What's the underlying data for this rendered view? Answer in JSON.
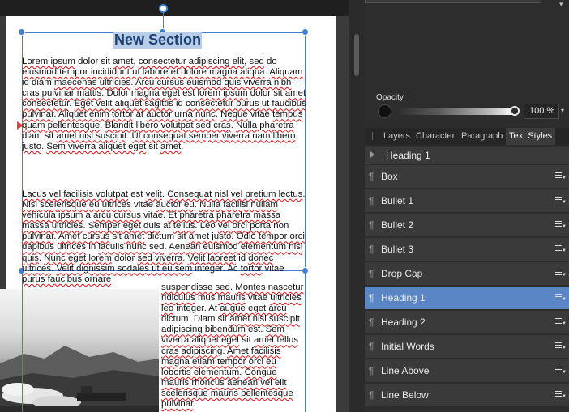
{
  "document": {
    "heading": "New Section",
    "paragraphs": [
      [
        {
          "t": "Lorem ipsum",
          "s": 1
        },
        {
          "t": " dolor sit "
        },
        {
          "t": "amet",
          "s": 1
        },
        {
          "t": ", "
        },
        {
          "t": "consectetur adipiscing elit",
          "s": 1
        },
        {
          "t": ", "
        },
        {
          "t": "sed",
          "s": 1
        },
        {
          "t": " do "
        },
        {
          "t": "eiusmod tempor incididunt ut labore et dolore magna aliqua",
          "s": 1
        },
        {
          "t": ". "
        },
        {
          "t": "Aliquam",
          "s": 1
        },
        {
          "t": " id diam "
        },
        {
          "t": "maecenas ultricies",
          "s": 1
        },
        {
          "t": ". "
        },
        {
          "t": "Arcu cursus euismod quis viverra nibh cras pulvinar mattis",
          "s": 1
        },
        {
          "t": ". Dolor "
        },
        {
          "t": "magna eget",
          "s": 1
        },
        {
          "t": " est "
        },
        {
          "t": "lorem ipsum",
          "s": 1
        },
        {
          "t": " dolor sit "
        },
        {
          "t": "amet consectetur",
          "s": 1
        },
        {
          "t": ". "
        },
        {
          "t": "Eget velit aliquet sagittis",
          "s": 1
        },
        {
          "t": " id "
        },
        {
          "t": "consectetur purus ut faucibus pulvinar",
          "s": 1
        },
        {
          "t": ". "
        },
        {
          "t": "Aliquet enim tortor",
          "s": 1
        },
        {
          "t": " at "
        },
        {
          "t": "auctor urna nunc",
          "s": 1
        },
        {
          "t": ". "
        },
        {
          "t": "Neque",
          "s": 1
        },
        {
          "t": " vitae "
        },
        {
          "t": "tempus quam pellentesque",
          "s": 1
        },
        {
          "t": ". "
        },
        {
          "t": "Blandit libero volutpat sed cras",
          "s": 1
        },
        {
          "t": ". "
        },
        {
          "t": "Nulla pharetra",
          "s": 1
        },
        {
          "t": " diam sit "
        },
        {
          "t": "amet nisl suscipit",
          "s": 1
        },
        {
          "t": ". "
        },
        {
          "t": "Ut consequat semper viverra nam libero justo",
          "s": 1
        },
        {
          "t": ". "
        },
        {
          "t": "Sem viverra aliquet eget",
          "s": 1
        },
        {
          "t": " sit "
        },
        {
          "t": "amet",
          "s": 1
        },
        {
          "t": "."
        }
      ],
      [
        {
          "t": "Lacus vel facilisis volutpat",
          "s": 1
        },
        {
          "t": " est "
        },
        {
          "t": "velit",
          "s": 1
        },
        {
          "t": ". "
        },
        {
          "t": "Consequat nisl vel pretium lectus",
          "s": 1
        },
        {
          "t": ". "
        },
        {
          "t": "Nisi scelerisque eu ultrices",
          "s": 1
        },
        {
          "t": " vitae "
        },
        {
          "t": "auctor eu",
          "s": 1
        },
        {
          "t": ". "
        },
        {
          "t": "Nulla facilisi nullam vehicula ipsum",
          "s": 1
        },
        {
          "t": " a "
        },
        {
          "t": "arcu cursus",
          "s": 1
        },
        {
          "t": " vitae. "
        },
        {
          "t": "Et pharetra pharetra massa massa ultricies",
          "s": 1
        },
        {
          "t": ". "
        },
        {
          "t": "Semper eget duis",
          "s": 1
        },
        {
          "t": " at "
        },
        {
          "t": "tellus",
          "s": 1
        },
        {
          "t": ". Leo "
        },
        {
          "t": "vel orci porta",
          "s": 1
        },
        {
          "t": " non "
        },
        {
          "t": "pulvinar",
          "s": 1
        },
        {
          "t": ". "
        },
        {
          "t": "Amet cursus",
          "s": 1
        },
        {
          "t": " sit "
        },
        {
          "t": "amet",
          "s": 1
        },
        {
          "t": " dictum sit "
        },
        {
          "t": "amet justo",
          "s": 1
        },
        {
          "t": ". "
        },
        {
          "t": "Odio tempor orci dapibus ultrices",
          "s": 1
        },
        {
          "t": " in "
        },
        {
          "t": "iaculis nunc sed",
          "s": 1
        },
        {
          "t": ". "
        },
        {
          "t": "Aenean euismod elementum nisi quis",
          "s": 1
        },
        {
          "t": ". "
        },
        {
          "t": "Nunc eget lorem",
          "s": 1
        },
        {
          "t": " dolor "
        },
        {
          "t": "sed viverra",
          "s": 1
        },
        {
          "t": ". "
        },
        {
          "t": "Velit laoreet",
          "s": 1
        },
        {
          "t": " id "
        },
        {
          "t": "donec ultrices",
          "s": 1
        },
        {
          "t": ". "
        },
        {
          "t": "Velit dignissim sodales ut eu sem",
          "s": 1
        },
        {
          "t": " integer. Ac "
        },
        {
          "t": "tortor",
          "s": 1
        },
        {
          "t": " vitae "
        },
        {
          "t": "purus faucibus ornare",
          "s": 1
        }
      ],
      [
        {
          "t": "suspendisse sed",
          "s": 1
        },
        {
          "t": ". "
        },
        {
          "t": "Montes nascetur ridiculus",
          "s": 1
        },
        {
          "t": " mus "
        },
        {
          "t": "mauris",
          "s": 1
        },
        {
          "t": " vitae "
        },
        {
          "t": "ultricies leo",
          "s": 1
        },
        {
          "t": " integer. At "
        },
        {
          "t": "augue eget arcu",
          "s": 1
        },
        {
          "t": " dictum. Diam sit "
        },
        {
          "t": "amet nisl suscipit adipiscing bibendum",
          "s": 1
        },
        {
          "t": " est. "
        },
        {
          "t": "Sem viverra aliquet eget",
          "s": 1
        },
        {
          "t": " sit "
        },
        {
          "t": "amet tellus cras adipiscing",
          "s": 1
        },
        {
          "t": ". "
        },
        {
          "t": "Amet facilisis magna etiam tempor orci eu lobortis elementum",
          "s": 1
        },
        {
          "t": ". "
        },
        {
          "t": "Congue mauris rhoncus aenean vel elit scelerisque mauris pellentesque pulvinar",
          "s": 1
        },
        {
          "t": "."
        }
      ]
    ]
  },
  "panel": {
    "opacity": {
      "label": "Opacity",
      "value": "100 %",
      "level": 1.0
    },
    "tabs": [
      "Layers",
      "Character",
      "Paragraph",
      "Text Styles"
    ],
    "active_tab": "Text Styles",
    "current_style": "Heading 1",
    "styles": [
      "Box",
      "Bullet 1",
      "Bullet 2",
      "Bullet 3",
      "Drop Cap",
      "Heading 1",
      "Heading 2",
      "Initial Words",
      "Line Above",
      "Line Below"
    ],
    "selected_style": "Heading 1",
    "colors": {
      "selection": "#3f7fd6",
      "selected_row": "#5b86c6",
      "spellcheck": "#e01010"
    }
  }
}
